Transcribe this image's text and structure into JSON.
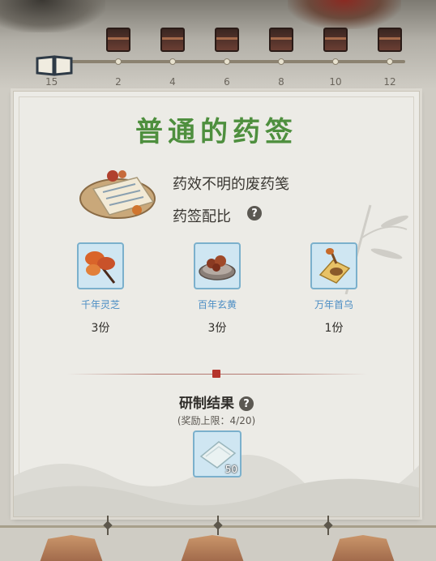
{
  "progress": {
    "start_label": "15",
    "milestones": [
      {
        "label": "2"
      },
      {
        "label": "4"
      },
      {
        "label": "6"
      },
      {
        "label": "8"
      },
      {
        "label": "10"
      },
      {
        "label": "12"
      }
    ]
  },
  "panel": {
    "title": "普通的药签",
    "item": {
      "icon": "medicine-paper-icon",
      "description": "药效不明的废药笺",
      "ratio_label": "药签配比"
    },
    "ingredients": [
      {
        "name": "千年灵芝",
        "quantity": "3份",
        "icon": "lingzhi-icon"
      },
      {
        "name": "百年玄黄",
        "quantity": "3份",
        "icon": "xuanhuang-icon"
      },
      {
        "name": "万年首乌",
        "quantity": "1份",
        "icon": "shouwu-icon"
      }
    ],
    "result": {
      "title": "研制结果",
      "limit_text": "(奖励上限：4/20)",
      "reward_count": "50",
      "reward_icon": "paper-scrap-icon"
    }
  },
  "colors": {
    "title_green": "#4e8f3e",
    "ingredient_blue": "#4c8ec4",
    "frame_blue": "#7bb0cc"
  }
}
